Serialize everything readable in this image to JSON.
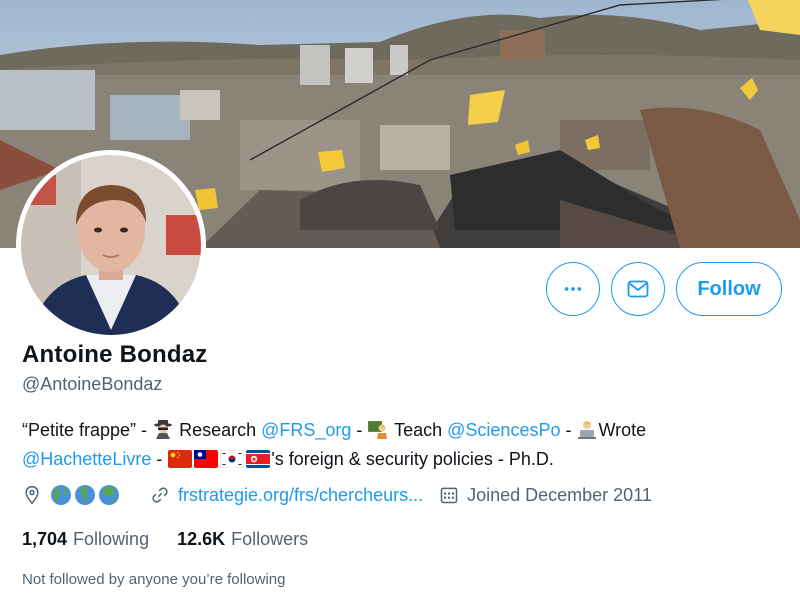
{
  "profile": {
    "name": "Antoine Bondaz",
    "handle": "@AntoineBondaz",
    "bio": {
      "quote": "“Petite frappe” - ",
      "research_label": " Research ",
      "research_link": "@FRS_org",
      "dash1": " - ",
      "teach_label": " Teach ",
      "teach_link": "@SciencesPo",
      "dash2": " - ",
      "wrote_label": "Wrote",
      "wrote_link": "@HachetteLivre",
      "dash3": " - ",
      "policies_text": "'s foreign & security policies - Ph.D."
    },
    "location_icon": "location-pin-icon",
    "website": "frstrategie.org/frs/chercheurs...",
    "joined": "Joined December 2011"
  },
  "actions": {
    "more_icon": "more-icon",
    "message_icon": "envelope-icon",
    "follow_label": "Follow"
  },
  "stats": {
    "following_count": "1,704",
    "following_label": "Following",
    "followers_count": "12.6K",
    "followers_label": "Followers"
  },
  "followed_by_note": "Not followed by anyone you’re following",
  "colors": {
    "accent": "#1d9bf0",
    "secondary_text": "#536471",
    "primary_text": "#0f1419"
  }
}
